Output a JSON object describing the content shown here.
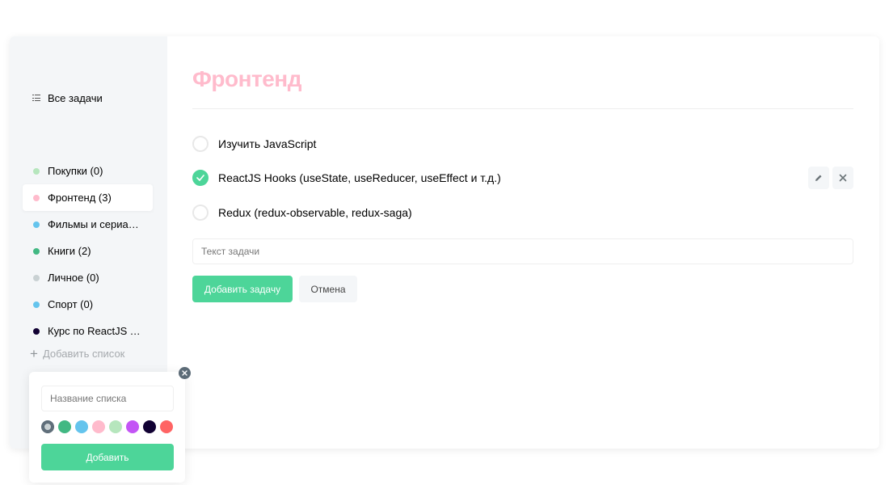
{
  "sidebar": {
    "all_tasks_label": "Все задачи",
    "lists": [
      {
        "label": "Покупки (0)",
        "color": "#b6e6bd"
      },
      {
        "label": "Фронтенд (3)",
        "color": "#ffbbcc"
      },
      {
        "label": "Фильмы и сериалы...",
        "color": "#64c4ed"
      },
      {
        "label": "Книги (2)",
        "color": "#42b883"
      },
      {
        "label": "Личное (0)",
        "color": "#c9d1d3"
      },
      {
        "label": "Спорт (0)",
        "color": "#64c4ed"
      },
      {
        "label": "Курс по ReactJS To...",
        "color": "#110133"
      }
    ],
    "active_index": 1,
    "add_list_label": "Добавить список"
  },
  "main": {
    "title": "Фронтенд",
    "title_color": "#ffbbcc",
    "tasks": [
      {
        "text": "Изучить JavaScript",
        "completed": false
      },
      {
        "text": "ReactJS Hooks (useState, useReducer, useEffect и т.д.)",
        "completed": true
      },
      {
        "text": "Redux (redux-observable, redux-saga)",
        "completed": false
      }
    ],
    "task_input_placeholder": "Текст задачи",
    "add_task_label": "Добавить задачу",
    "cancel_label": "Отмена"
  },
  "popup": {
    "input_placeholder": "Название списка",
    "colors": [
      "#c9d1d3",
      "#42b883",
      "#64c4ed",
      "#ffbbcc",
      "#b6e6bd",
      "#c355f5",
      "#110133",
      "#ff6464"
    ],
    "selected_color_index": 0,
    "add_label": "Добавить"
  },
  "icons": {
    "all_tasks": "list-icon",
    "edit": "pencil-icon",
    "delete": "close-icon",
    "add": "plus-icon",
    "popup_close": "close-icon",
    "check": "check-icon"
  },
  "accent_color": "#4dd599"
}
